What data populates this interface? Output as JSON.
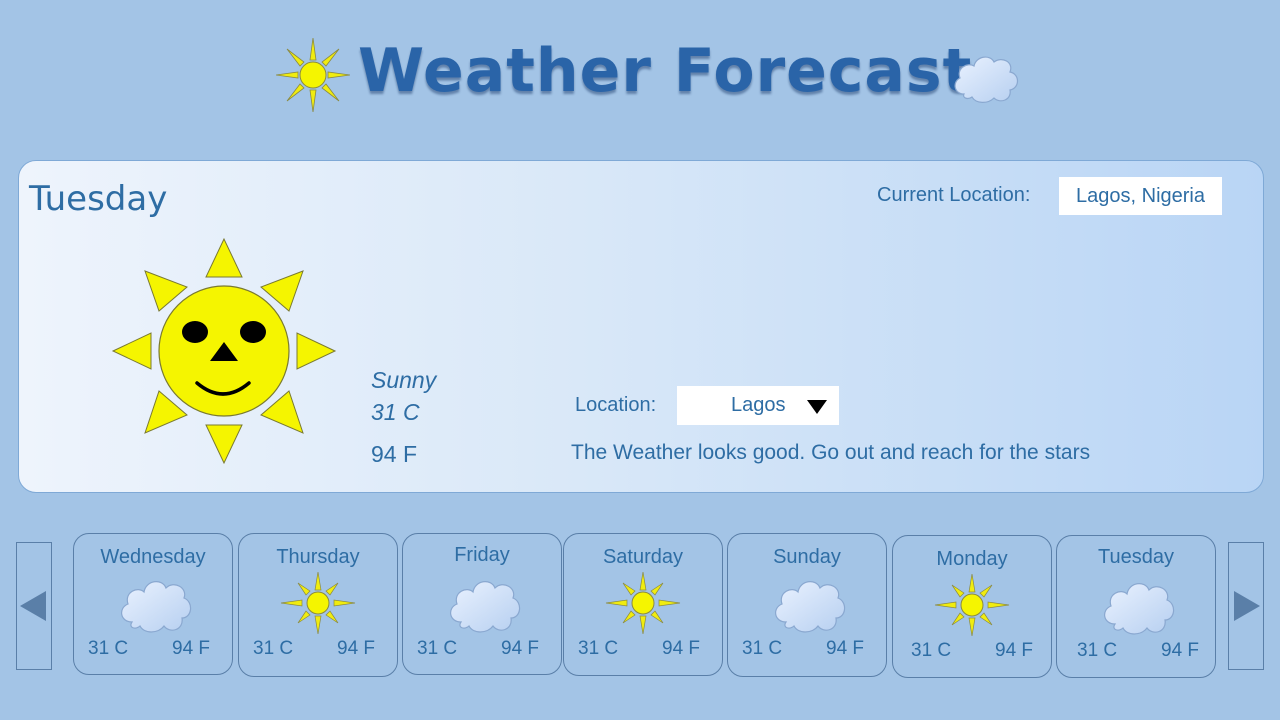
{
  "header": {
    "title": "Weather Forecast",
    "left_icon": "sun-icon",
    "right_icon": "cloud-icon"
  },
  "colors": {
    "background": "#a3c4e6",
    "text": "#2e6da4",
    "title": "#2a64a8",
    "sun": "#f5f500",
    "sun_ray": "#f0ec10"
  },
  "today": {
    "day": "Tuesday",
    "condition": "Sunny",
    "temp_c": "31 C",
    "temp_f": "94 F",
    "icon": "smiling-sun-icon",
    "current_location_label": "Current Location:",
    "current_location_value": "Lagos, Nigeria",
    "location_label": "Location:",
    "location_selected": "Lagos",
    "message": "The Weather looks good. Go out and reach for the stars"
  },
  "forecast": [
    {
      "day": "Wednesday",
      "icon": "cloud-icon",
      "temp_c": "31 C",
      "temp_f": "94 F"
    },
    {
      "day": "Thursday",
      "icon": "sun-icon",
      "temp_c": "31 C",
      "temp_f": "94 F"
    },
    {
      "day": "Friday",
      "icon": "cloud-icon",
      "temp_c": "31 C",
      "temp_f": "94 F"
    },
    {
      "day": "Saturday",
      "icon": "sun-icon",
      "temp_c": "31 C",
      "temp_f": "94 F"
    },
    {
      "day": "Sunday",
      "icon": "cloud-icon",
      "temp_c": "31 C",
      "temp_f": "94 F"
    },
    {
      "day": "Monday",
      "icon": "sun-icon",
      "temp_c": "31 C",
      "temp_f": "94 F"
    },
    {
      "day": "Tuesday",
      "icon": "cloud-icon",
      "temp_c": "31 C",
      "temp_f": "94 F"
    }
  ],
  "nav": {
    "prev_icon": "triangle-left-icon",
    "next_icon": "triangle-right-icon"
  }
}
